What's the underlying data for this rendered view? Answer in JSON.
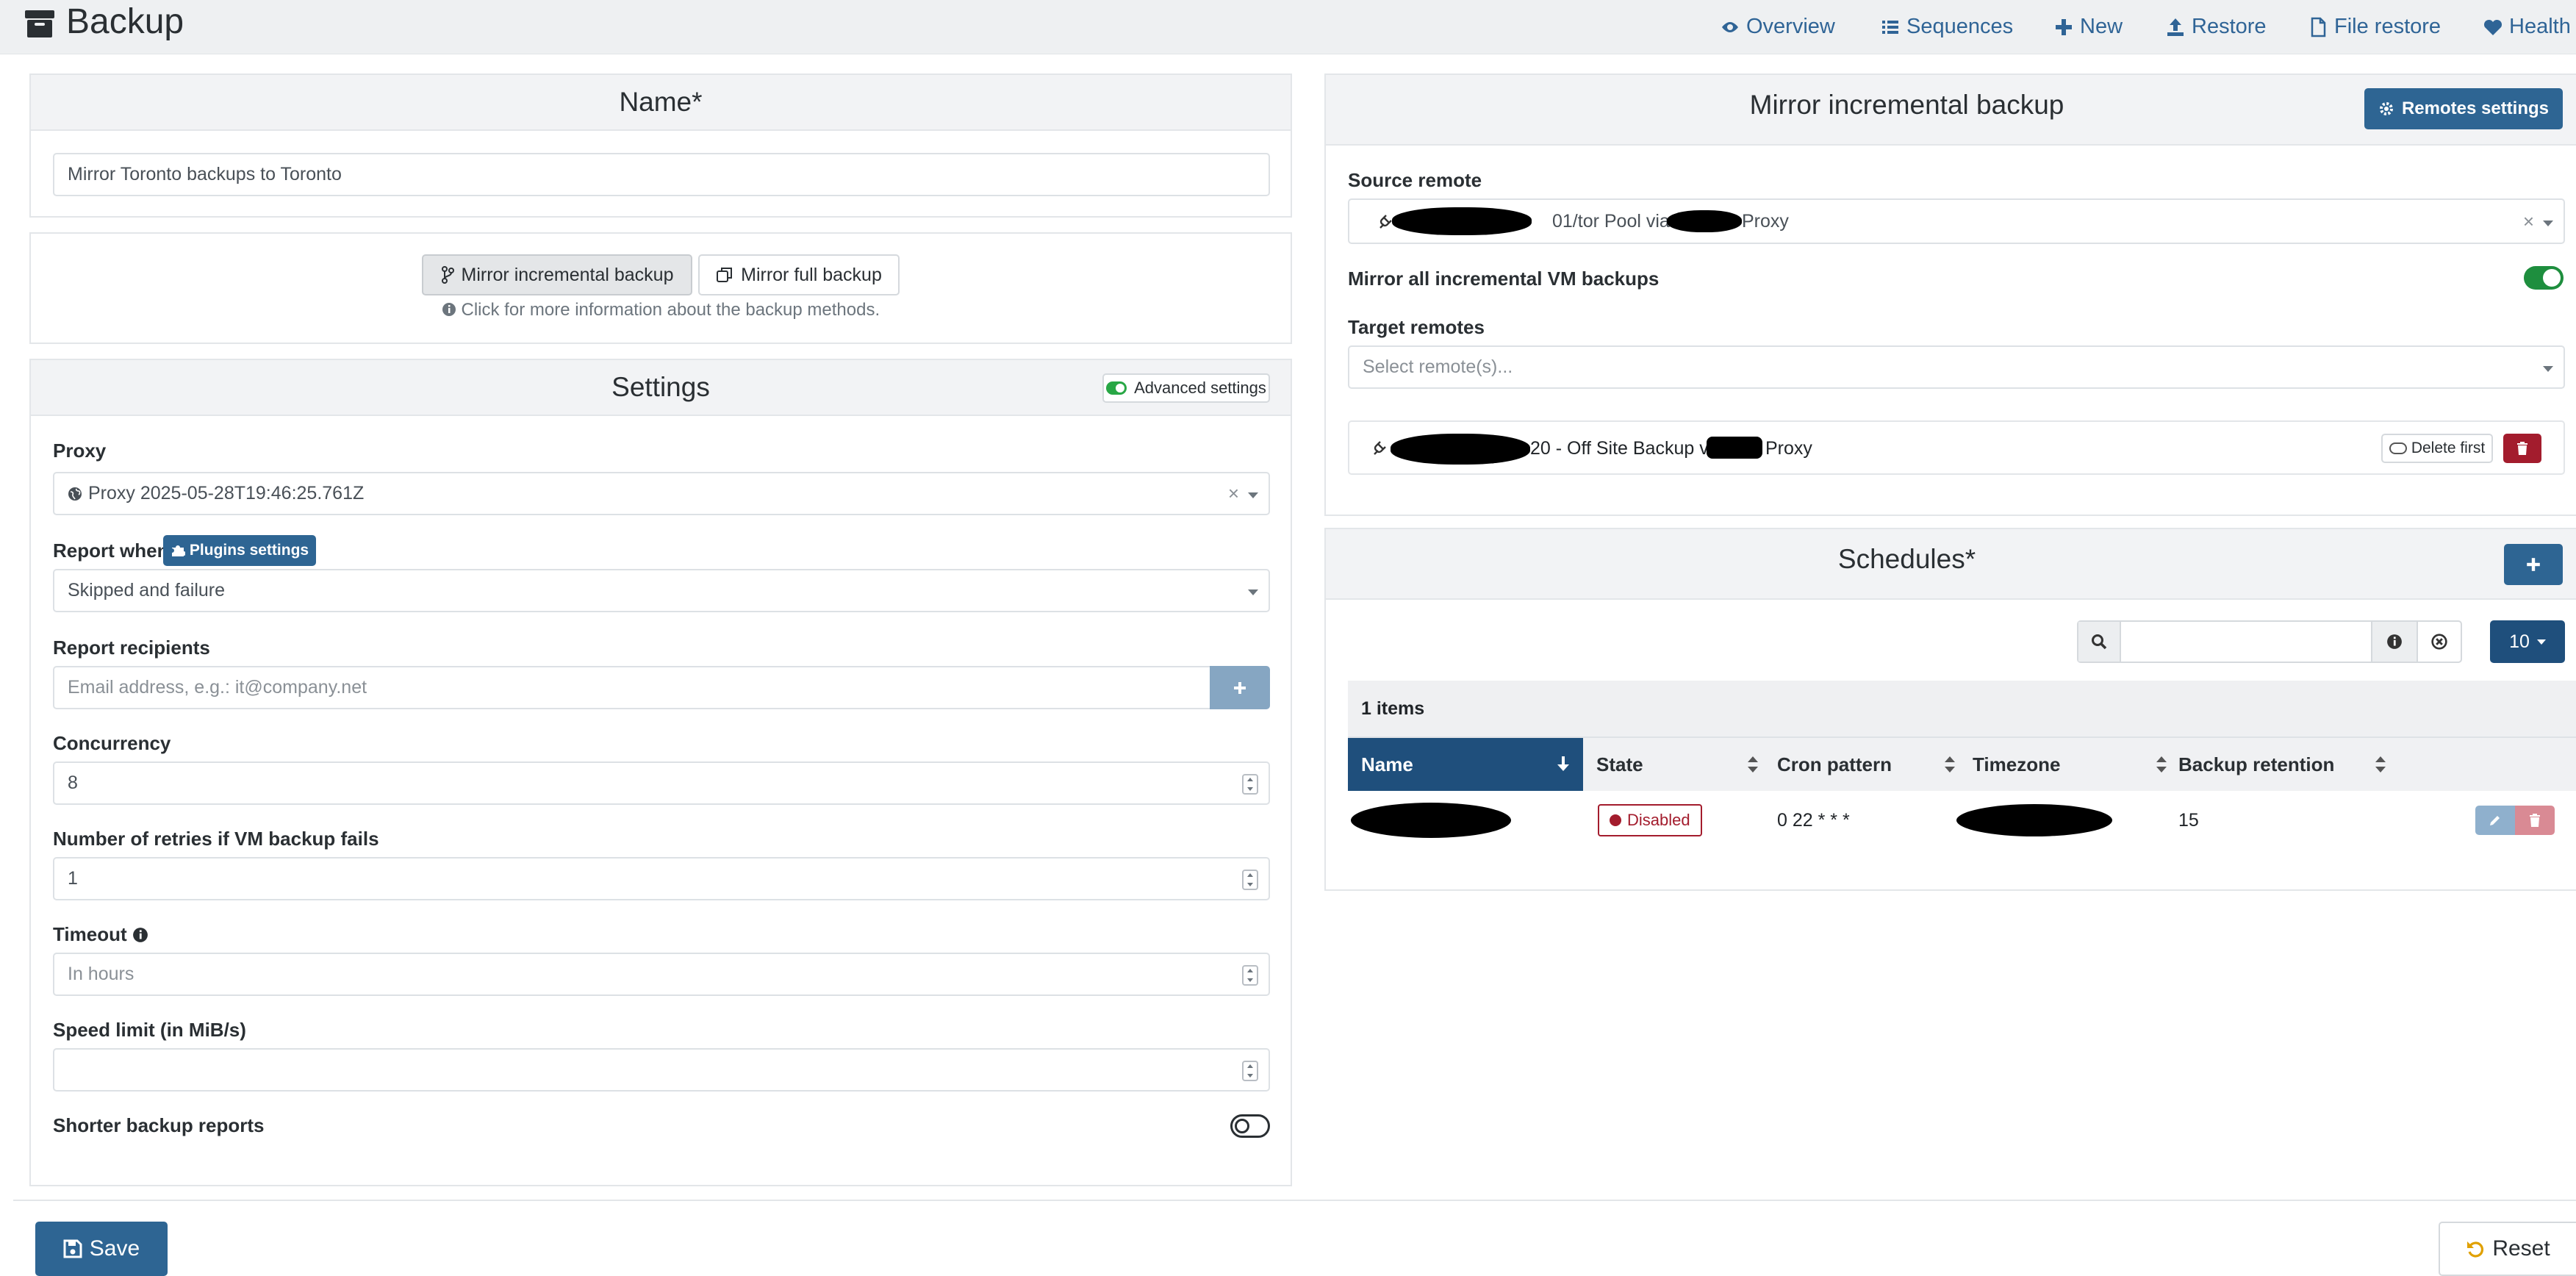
{
  "app": {
    "title": "Backup"
  },
  "nav": [
    {
      "label": "Overview",
      "icon": "eye-icon"
    },
    {
      "label": "Sequences",
      "icon": "list-icon"
    },
    {
      "label": "New",
      "icon": "plus-icon"
    },
    {
      "label": "Restore",
      "icon": "upload-icon"
    },
    {
      "label": "File restore",
      "icon": "file-icon"
    },
    {
      "label": "Health",
      "icon": "heartbeat-icon"
    }
  ],
  "name_panel": {
    "title": "Name*",
    "value": "Mirror Toronto backups to Toronto"
  },
  "mode_panel": {
    "incremental_label": "Mirror incremental backup",
    "full_label": "Mirror full backup",
    "info_text": "Click for more information about the backup methods.",
    "selected": "Mirror incremental backup"
  },
  "settings": {
    "title": "Settings",
    "advanced_label": "Advanced settings",
    "proxy_label": "Proxy",
    "proxy_value": "Proxy 2025-05-28T19:46:25.761Z",
    "report_when_label": "Report when",
    "plugins_label": "Plugins settings",
    "report_when_value": "Skipped and failure",
    "recipients_label": "Report recipients",
    "recipients_placeholder": "Email address, e.g.: it@company.net",
    "concurrency_label": "Concurrency",
    "concurrency_value": "8",
    "retries_label": "Number of retries if VM backup fails",
    "retries_value": "1",
    "timeout_label": "Timeout",
    "timeout_placeholder": "In hours",
    "speed_label": "Speed limit (in MiB/s)",
    "speed_value": "",
    "shorter_label": "Shorter backup reports",
    "shorter_enabled": false
  },
  "mirror": {
    "title": "Mirror incremental backup",
    "remotes_settings_label": "Remotes settings",
    "source_label": "Source remote",
    "source_value_a": "01/tor Pool via",
    "source_value_b": "Proxy",
    "mirror_all_label": "Mirror all incremental VM backups",
    "mirror_all_enabled": true,
    "target_label": "Target remotes",
    "target_placeholder": "Select remote(s)...",
    "target_item_a": "20 - Off Site Backup via",
    "target_item_b": "Proxy",
    "delete_first_label": "Delete first"
  },
  "schedules": {
    "title": "Schedules*",
    "page_size": "10",
    "items_count": "1 items",
    "columns": [
      "Name",
      "State",
      "Cron pattern",
      "Timezone",
      "Backup retention"
    ],
    "rows": [
      {
        "state": "Disabled",
        "cron": "0 22 * * *",
        "retention": "15"
      }
    ]
  },
  "footer": {
    "save_label": "Save",
    "reset_label": "Reset"
  },
  "colors": {
    "accent": "#2e6593",
    "danger": "#a31c2d",
    "success": "#28a745",
    "link": "#2f6496"
  }
}
